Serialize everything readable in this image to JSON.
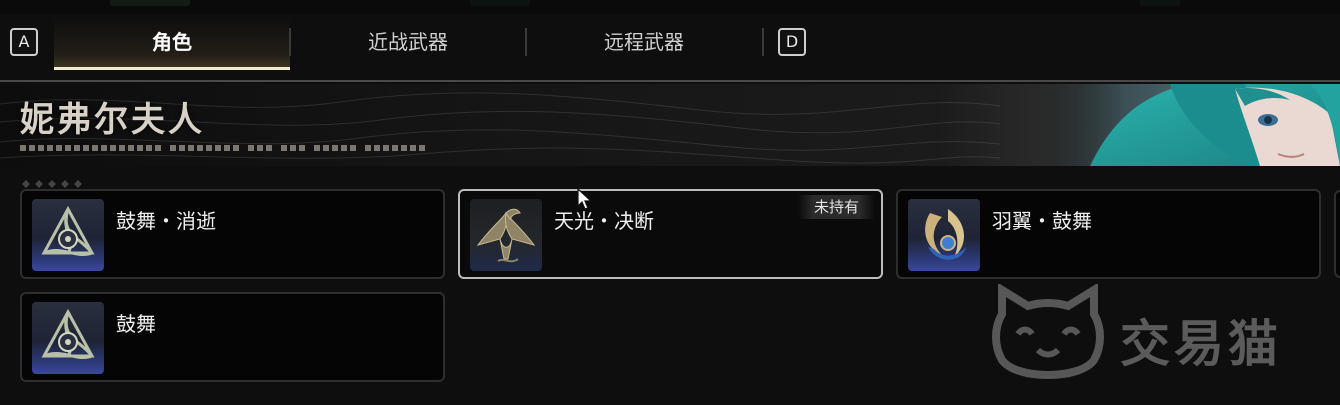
{
  "tabs": {
    "left_key": "A",
    "right_key": "D",
    "items": [
      {
        "label": "角色",
        "active": true
      },
      {
        "label": "近战武器",
        "active": false
      },
      {
        "label": "远程武器",
        "active": false
      }
    ]
  },
  "banner": {
    "title": "妮弗尔夫人"
  },
  "cards": [
    {
      "name": "鼓舞・消逝",
      "icon": "tri-knot-emblem-icon",
      "selected": false
    },
    {
      "name": "天光・决断",
      "icon": "dragon-emblem-icon",
      "selected": true,
      "badge": "未持有"
    },
    {
      "name": "羽翼・鼓舞",
      "icon": "wing-swirl-emblem-icon",
      "selected": false
    },
    {
      "name": "鼓舞",
      "icon": "tri-knot-emblem-icon",
      "selected": false
    }
  ],
  "watermark": {
    "text": "交易猫"
  },
  "colors": {
    "background": "#0e0e0f",
    "tab_underline": "#f3ecd0",
    "selected_border": "#bdbdbd",
    "thumb_blue": "#3b48a0"
  }
}
